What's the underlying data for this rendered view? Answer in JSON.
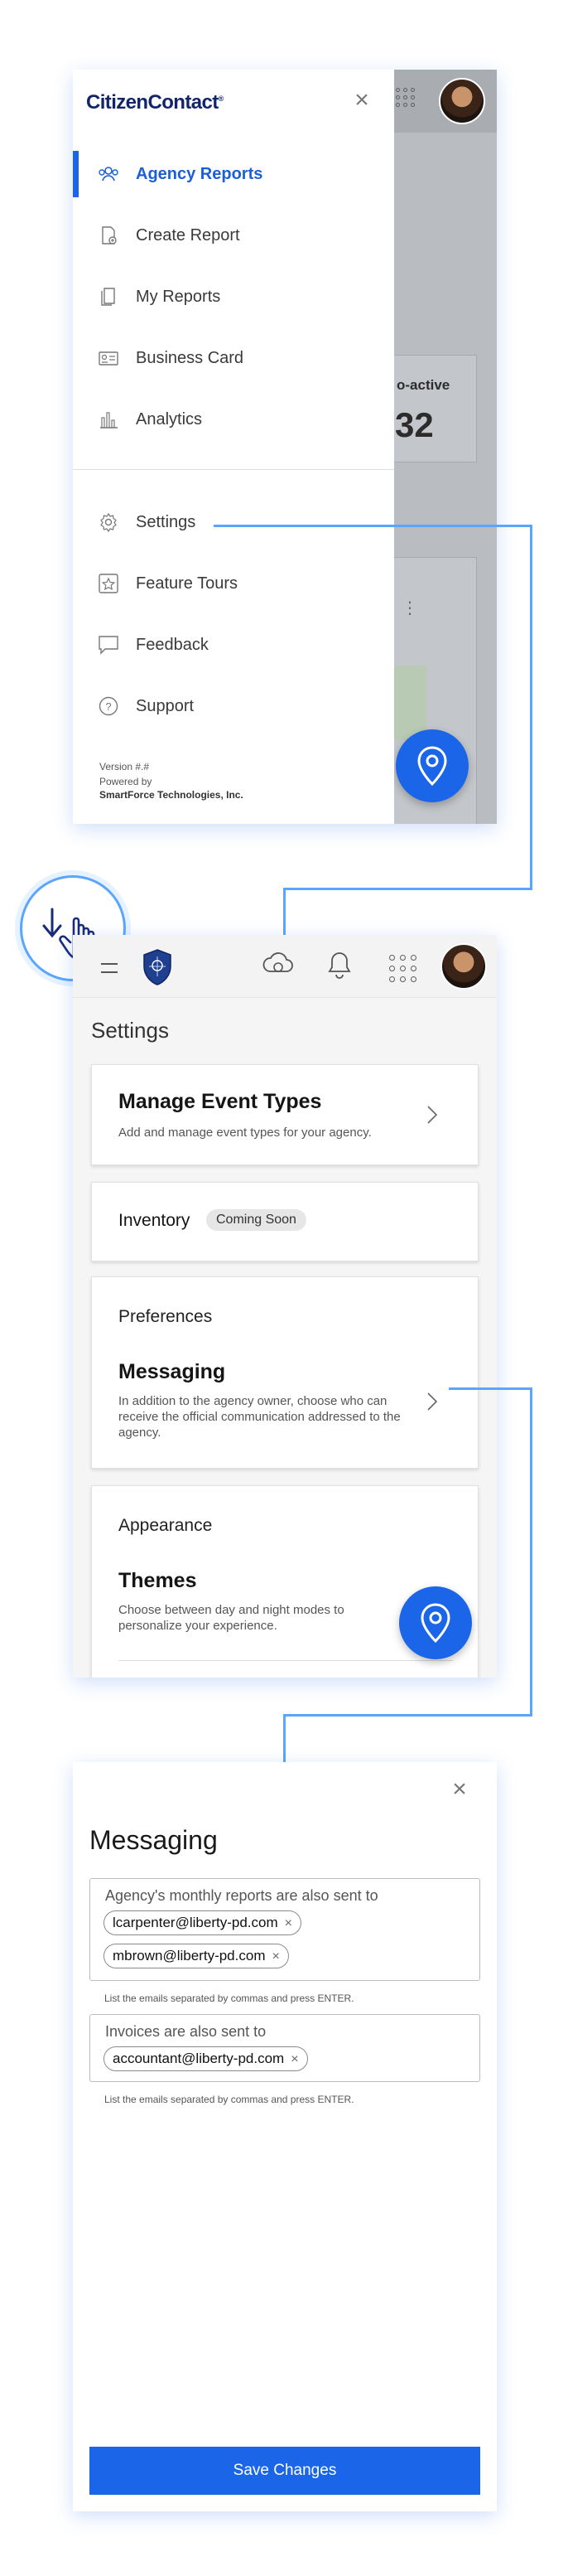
{
  "drawer": {
    "logo": "CitizenContact",
    "logo_mark": "®",
    "items": [
      {
        "label": "Agency Reports",
        "icon": "people-icon",
        "active": true
      },
      {
        "label": "Create Report",
        "icon": "new-report-icon"
      },
      {
        "label": "My Reports",
        "icon": "documents-icon"
      },
      {
        "label": "Business Card",
        "icon": "id-card-icon"
      },
      {
        "label": "Analytics",
        "icon": "bar-chart-icon"
      }
    ],
    "secondary_items": [
      {
        "label": "Settings",
        "icon": "gear-icon"
      },
      {
        "label": "Feature Tours",
        "icon": "star-icon"
      },
      {
        "label": "Feedback",
        "icon": "speech-bubble-icon"
      },
      {
        "label": "Support",
        "icon": "question-icon"
      }
    ],
    "version": "Version #.#",
    "powered_by": "Powered by",
    "company": "SmartForce Technologies, Inc."
  },
  "background_card": {
    "title_fragment": "o-active",
    "value_fragment": "32"
  },
  "settings": {
    "title": "Settings",
    "manage_events": {
      "title": "Manage Event Types",
      "subtitle": "Add and manage event types for your agency."
    },
    "inventory": {
      "title": "Inventory",
      "badge": "Coming Soon"
    },
    "preferences": {
      "section": "Preferences",
      "title": "Messaging",
      "subtitle": "In addition to the agency owner, choose who can receive the official communication addressed to the agency."
    },
    "appearance": {
      "section": "Appearance",
      "title": "Themes",
      "subtitle": "Choose between day and night modes to personalize your experience."
    }
  },
  "messaging": {
    "title": "Messaging",
    "monthly_label": "Agency's monthly reports are also sent to",
    "monthly_emails": [
      "lcarpenter@liberty-pd.com",
      "mbrown@liberty-pd.com"
    ],
    "monthly_hint": "List the emails separated by commas and press ENTER.",
    "invoices_label": "Invoices are also sent to",
    "invoice_emails": [
      "accountant@liberty-pd.com"
    ],
    "invoices_hint": "List the emails separated by commas and press ENTER.",
    "save_label": "Save Changes",
    "remove_glyph": "×"
  },
  "colors": {
    "accent": "#1b66e8",
    "connector": "#5aa5ff",
    "brand_navy": "#12256b"
  }
}
